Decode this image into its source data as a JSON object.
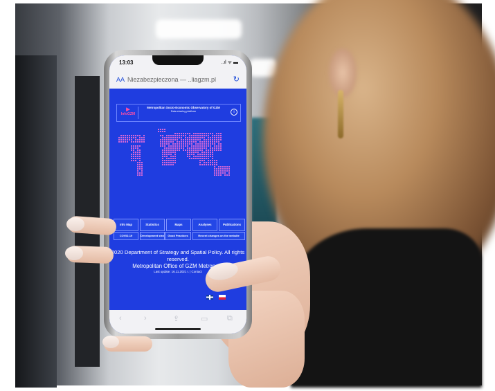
{
  "status_bar": {
    "time": "13:03",
    "signal": "..ıl ᯤ ▬"
  },
  "address_bar": {
    "aa": "AA",
    "url": "Niezabezpieczona — ..liagzm.pl",
    "reload": "↻"
  },
  "site_header": {
    "logo_text": "InfoGZM",
    "title": "Metropolitan Socio-Economic Observatory of GZM",
    "subtitle": "Data sharing platform",
    "info_glyph": "i"
  },
  "nav_buttons": [
    "Info Map",
    "Statistics",
    "Maps",
    "Analyses",
    "Publications"
  ],
  "sub_buttons": [
    "COVID-19",
    "Development strategy",
    "Good Practices",
    "Recent changes on the website"
  ],
  "footer": {
    "line1": "2020 Department of Strategy and Spatial Policy. All rights reserved.",
    "line2": "Metropolitan Office of GZM Metropolis",
    "last_update": "Last update: 16.11.2021 r. | Contact"
  },
  "colors": {
    "site_bg": "#1f3de0",
    "accent": "#ff4fa4",
    "map_dots": "#d468d8"
  },
  "toolbar_icons": [
    "back-icon",
    "forward-icon",
    "share-icon",
    "bookmarks-icon",
    "tabs-icon"
  ]
}
